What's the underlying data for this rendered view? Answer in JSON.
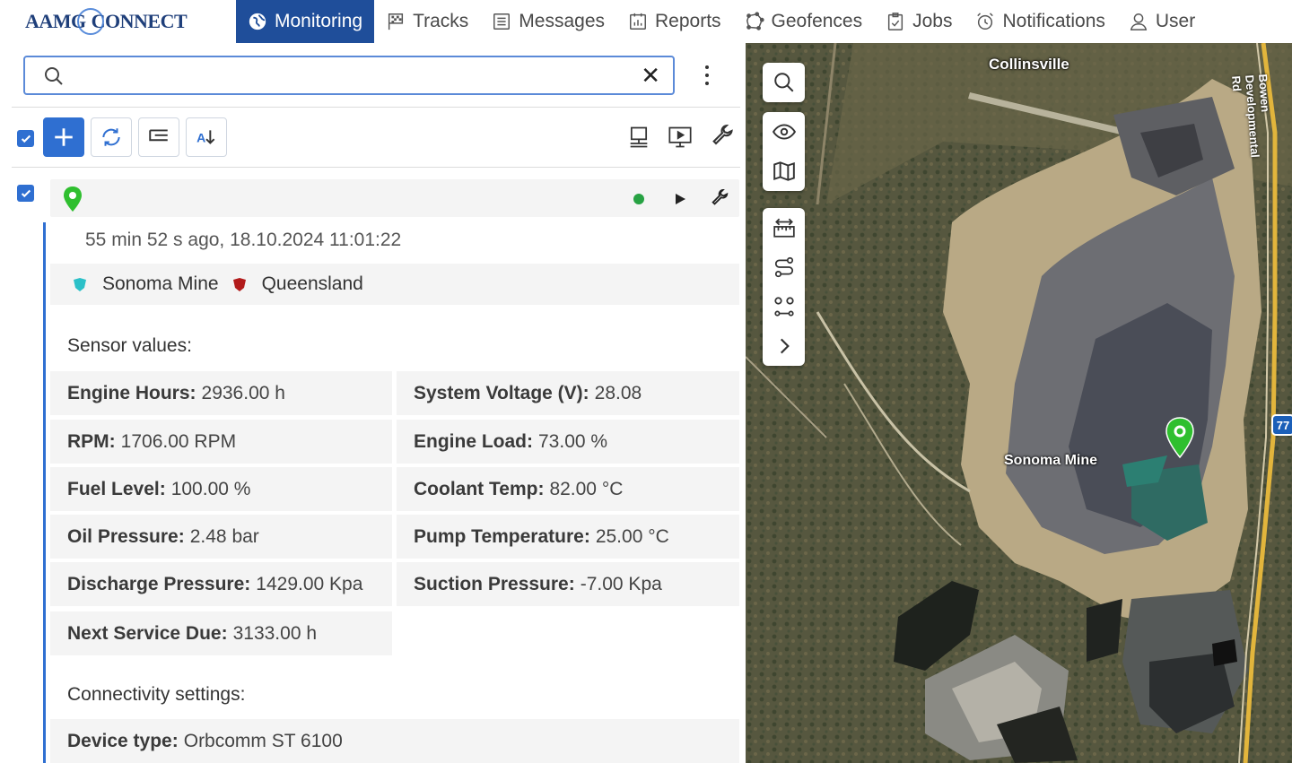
{
  "brand": {
    "logo_text_left": "AAMG",
    "logo_text_right": "CONNECT"
  },
  "nav": {
    "items": [
      {
        "label": "Monitoring",
        "icon": "globe-icon",
        "active": true
      },
      {
        "label": "Tracks",
        "icon": "flag-icon"
      },
      {
        "label": "Messages",
        "icon": "messages-icon"
      },
      {
        "label": "Reports",
        "icon": "reports-icon"
      },
      {
        "label": "Geofences",
        "icon": "geofence-icon"
      },
      {
        "label": "Jobs",
        "icon": "jobs-icon"
      },
      {
        "label": "Notifications",
        "icon": "alarm-clock-icon"
      },
      {
        "label": "User",
        "icon": "user-icon"
      }
    ]
  },
  "search": {
    "value": "",
    "placeholder": ""
  },
  "unit": {
    "last_update": "55 min 52 s ago, 18.10.2024 11:01:22",
    "status_color": "#27a243",
    "geofences": [
      {
        "name": "Sonoma Mine",
        "color": "#2bc0c8"
      },
      {
        "name": "Queensland",
        "color": "#b21b1b"
      }
    ]
  },
  "sensors": {
    "title": "Sensor values:",
    "items": [
      {
        "key": "Engine Hours:",
        "value": "2936.00 h"
      },
      {
        "key": "System Voltage (V):",
        "value": "28.08"
      },
      {
        "key": "RPM:",
        "value": "1706.00 RPM"
      },
      {
        "key": "Engine Load:",
        "value": "73.00 %"
      },
      {
        "key": "Fuel Level:",
        "value": "100.00 %"
      },
      {
        "key": "Coolant Temp:",
        "value": "82.00 °C"
      },
      {
        "key": "Oil Pressure:",
        "value": "2.48 bar"
      },
      {
        "key": "Pump Temperature:",
        "value": "25.00 °C"
      },
      {
        "key": "Discharge Pressure:",
        "value": "1429.00 Kpa"
      },
      {
        "key": "Suction Pressure:",
        "value": "-7.00 Kpa"
      },
      {
        "key": "Next Service Due:",
        "value": "3133.00 h"
      }
    ]
  },
  "connectivity": {
    "title": "Connectivity settings:",
    "items": [
      {
        "key": "Device type:",
        "value": "Orbcomm ST 6100"
      }
    ]
  },
  "map": {
    "town_label": "Collinsville",
    "site_label": "Sonoma Mine",
    "road_label": "Bowen Developmental Rd",
    "route_shield": "77"
  },
  "colors": {
    "accent": "#2f6fd1",
    "nav_active": "#1f4e9a",
    "pin": "#2fbf2f"
  }
}
